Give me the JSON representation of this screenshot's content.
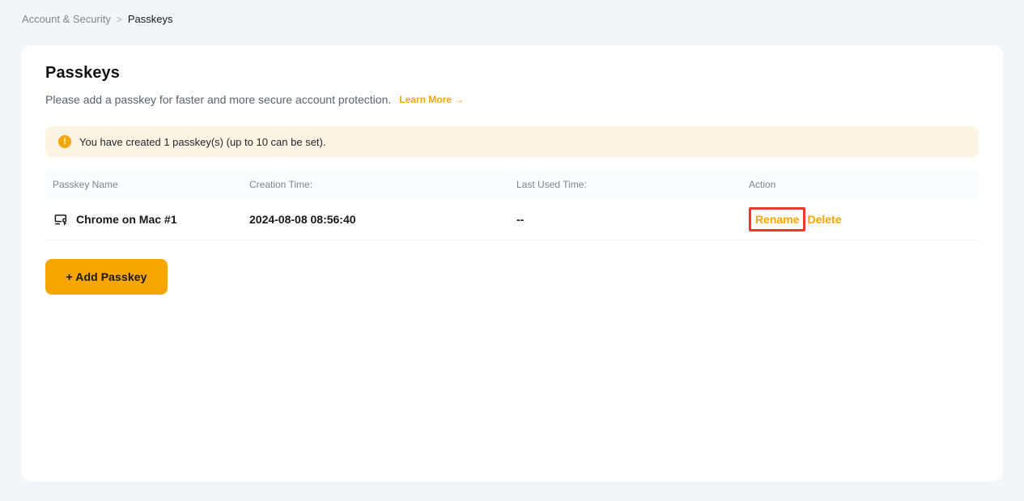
{
  "breadcrumb": {
    "section": "Account & Security",
    "separator": ">",
    "current": "Passkeys"
  },
  "header": {
    "title": "Passkeys",
    "description": "Please add a passkey for faster and more secure account protection.",
    "learn_more_label": "Learn More",
    "learn_more_arrow": "→"
  },
  "banner": {
    "icon_glyph": "!",
    "text": "You have created 1 passkey(s) (up to 10 can be set)."
  },
  "table": {
    "headers": [
      "Passkey Name",
      "Creation Time:",
      "Last Used Time:",
      "Action"
    ],
    "rows": [
      {
        "name": "Chrome on Mac #1",
        "creation_time": "2024-08-08 08:56:40",
        "last_used_time": "--",
        "rename_label": "Rename",
        "delete_label": "Delete"
      }
    ]
  },
  "actions": {
    "add_passkey_label": "+ Add Passkey"
  },
  "colors": {
    "accent_orange": "#f7a600",
    "banner_background": "#fdf4e3",
    "highlight_red": "#f0372e",
    "page_background": "#f4f5f9",
    "card_background": "#ffffff",
    "text_primary": "#17181c",
    "text_secondary": "#81858c"
  }
}
